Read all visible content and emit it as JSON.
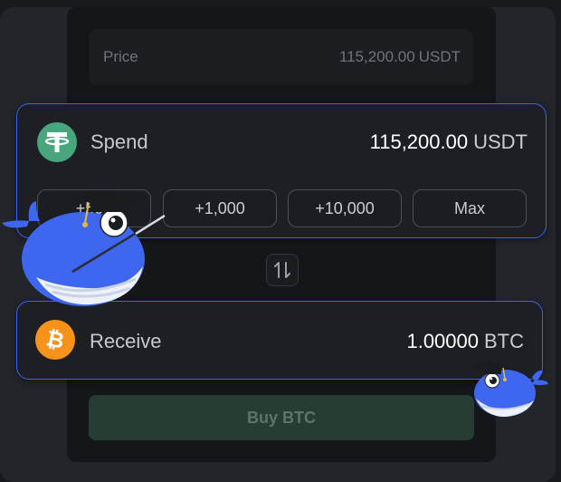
{
  "price": {
    "label": "Price",
    "value": "115,200.00",
    "unit": "USDT"
  },
  "spend": {
    "label": "Spend",
    "amount": "115,200.00",
    "unit": "USDT",
    "coin_icon": "tether-icon",
    "quick_amounts": [
      "+500",
      "+1,000",
      "+10,000",
      "Max"
    ]
  },
  "swap_icon": "swap-arrows-icon",
  "receive": {
    "label": "Receive",
    "amount": "1.00000",
    "unit": "BTC",
    "coin_icon": "bitcoin-icon"
  },
  "buy_button": {
    "label": "Buy BTC"
  },
  "colors": {
    "accent_border": "#3a63f0",
    "tether_green": "#48a67f",
    "bitcoin_orange": "#f7931a",
    "buy_disabled_bg": "#253d33"
  }
}
